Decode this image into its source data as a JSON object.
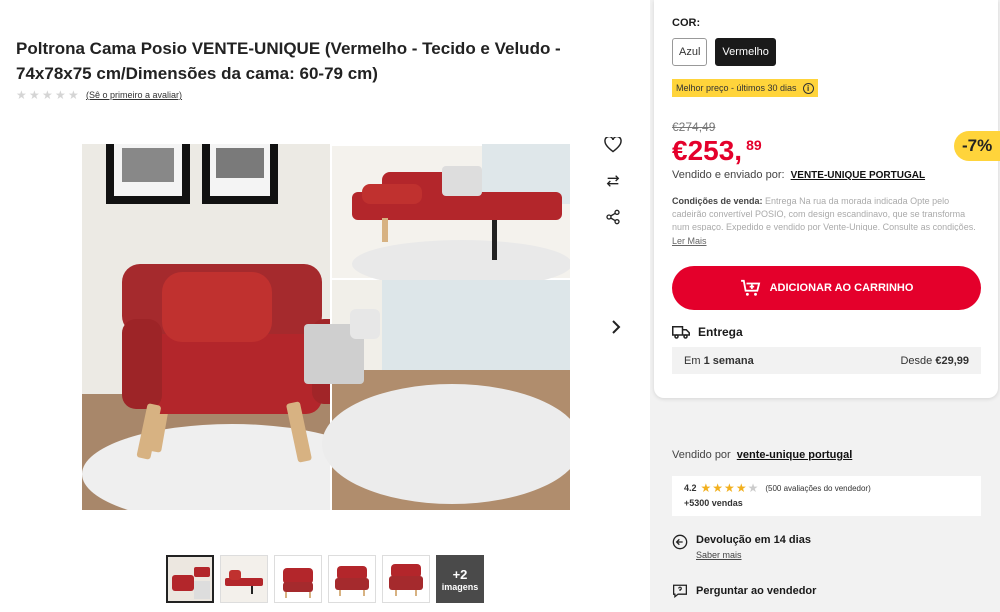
{
  "product": {
    "title": "Poltrona Cama Posio VENTE-UNIQUE (Vermelho - Tecido e Veludo - 74x78x75 cm/Dimensões da cama: 60-79 cm)",
    "rating_link": "(Sê o primeiro a avaliar)",
    "rating_value": 0,
    "rating_max": 5
  },
  "gallery": {
    "more_count": "+2",
    "more_label": "imagens",
    "thumbnails": 5
  },
  "options": {
    "label": "COR:",
    "colors": [
      {
        "label": "Azul",
        "selected": false
      },
      {
        "label": "Vermelho",
        "selected": true
      }
    ]
  },
  "pricing": {
    "best_price_badge": "Melhor preço - últimos 30 dias",
    "old_price": "€274,49",
    "price_main": "€253,",
    "price_cents": "89",
    "discount": "-7%",
    "sold_shipped_label": "Vendido e enviado por:",
    "seller": "VENTE-UNIQUE PORTUGAL"
  },
  "conditions": {
    "label": "Condições de venda:",
    "text": "Entrega Na rua da morada indicada Opte pelo cadeirão convertível POSIO, com design escandinavo, que se transforma num espaço. Expedido e vendido por Vente-Unique. Consulte as condições.",
    "read_more": "Ler Mais"
  },
  "cart": {
    "add_label": "ADICIONAR AO CARRINHO"
  },
  "delivery": {
    "title": "Entrega",
    "time_prefix": "Em",
    "time_value": "1 semana",
    "from_label": "Desde",
    "from_price": "€29,99"
  },
  "seller_info": {
    "sold_by_label": "Vendido por",
    "seller_link": "vente-unique portugal",
    "score": "4.2",
    "stars_filled": 4,
    "reviews": "(500 avaliações do vendedor)",
    "sales": "+5300 vendas",
    "return_title": "Devolução em 14 dias",
    "return_link": "Saber mais",
    "ask_label": "Perguntar ao vendedor"
  },
  "colors": {
    "accent_red": "#e4002b",
    "badge_yellow": "#ffd43b",
    "sofa_red": "#b3262b"
  }
}
